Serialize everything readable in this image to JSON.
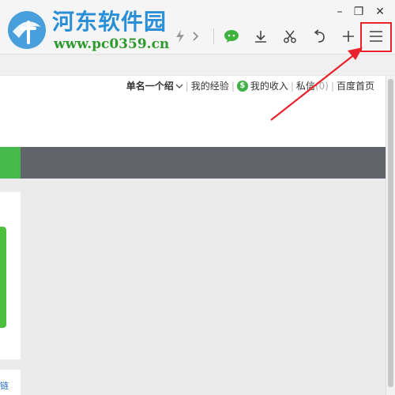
{
  "watermark": {
    "brand": "河东软件园",
    "url": "www.pc0359.cn"
  },
  "window_controls": {
    "minimize": "–",
    "restore": "❐",
    "close": "✕"
  },
  "user_bar": {
    "username": "单名一个绍",
    "experience": "我的经验",
    "income": "我的收入",
    "coin_symbol": "$",
    "messages": "私信",
    "message_count": "(0)",
    "homepage": "百度首页"
  },
  "footer_link": "链",
  "colors": {
    "accent_green": "#47b94c",
    "nav_gray": "#62646c",
    "highlight_red": "#e8232b",
    "brand_blue": "#2a8fd6",
    "url_green": "#2f9a2f"
  },
  "toolbar_icons": [
    "flash-icon",
    "chevron-right-icon",
    "wechat-icon",
    "download-icon",
    "scissors-icon",
    "undo-icon",
    "plus-icon",
    "menu-icon"
  ]
}
